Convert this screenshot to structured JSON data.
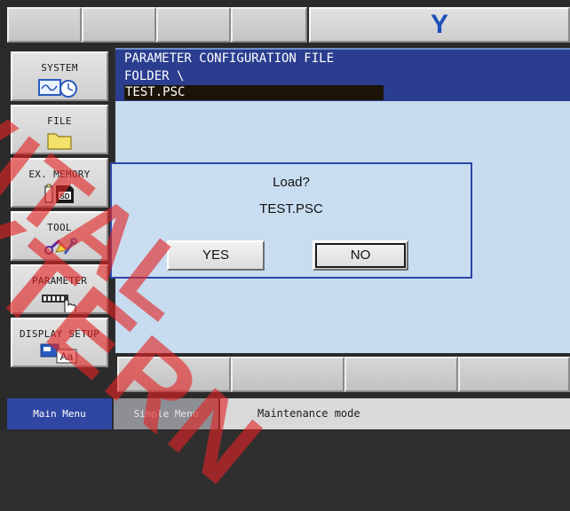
{
  "top_toolbar": {
    "logo_letter": "Y",
    "brand_color": "#1c4fb8"
  },
  "left_menu": {
    "items": [
      {
        "label": "SYSTEM",
        "icon": "system-clock-monitor-icon"
      },
      {
        "label": "FILE",
        "icon": "folder-icon"
      },
      {
        "label": "EX. MEMORY",
        "icon": "sd-card-icon"
      },
      {
        "label": "TOOL",
        "icon": "tool-icon"
      },
      {
        "label": "PARAMETER",
        "icon": "parameter-hand-icon"
      },
      {
        "label": "DISPLAY SETUP",
        "icon": "display-setup-icon"
      }
    ]
  },
  "screen": {
    "title": "PARAMETER CONFIGURATION FILE",
    "folder": "FOLDER \\",
    "selected_file": "TEST.PSC",
    "header_color": "#2a3d8f",
    "background_color": "#c7dcef"
  },
  "dialog": {
    "question": "Load?",
    "file_name": "TEST.PSC",
    "yes_label": "YES",
    "no_label": "NO"
  },
  "bottom_bar": {
    "main_menu": "Main Menu",
    "simple_menu": "Simple Menu",
    "mode": "Maintenance mode"
  },
  "watermark": {
    "line1": "VITAL",
    "line2": "XTERN"
  }
}
